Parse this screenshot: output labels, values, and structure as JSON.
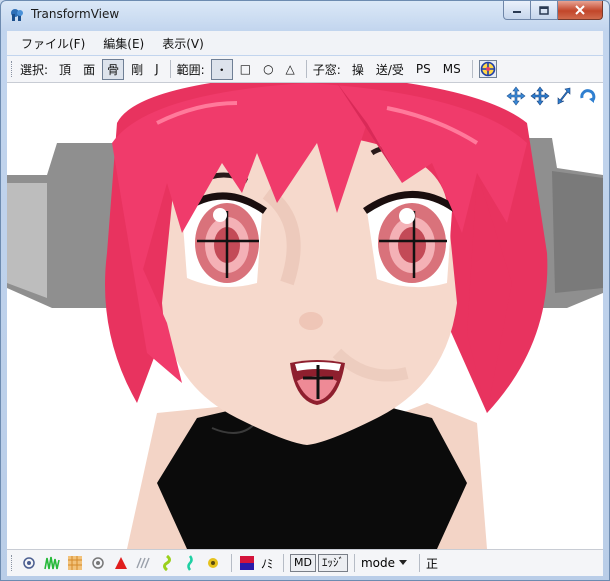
{
  "window": {
    "title": "TransformView"
  },
  "menu": [
    {
      "label": "ファイル(F)"
    },
    {
      "label": "編集(E)"
    },
    {
      "label": "表示(V)"
    }
  ],
  "toolbar": {
    "select_label": "選択:",
    "select_modes": [
      "頂",
      "面",
      "骨",
      "剛",
      "J"
    ],
    "range_label": "範囲:",
    "range_modes": [
      "・",
      "□",
      "○",
      "△"
    ],
    "child_label": "子窓:",
    "child_items": [
      "操",
      "送/受",
      "PS",
      "MS"
    ]
  },
  "statusbar": {
    "md_label": "MD",
    "edge_label": "ｴｯｼﾞ",
    "nomi_label": "ﾉﾐ",
    "mode_label": "mode",
    "sei_label": "正"
  },
  "colors": {
    "hair": "#f03b6b",
    "skin": "#f6d9cc",
    "device": "#8f8f8f",
    "clothing": "#0b0b0b"
  }
}
